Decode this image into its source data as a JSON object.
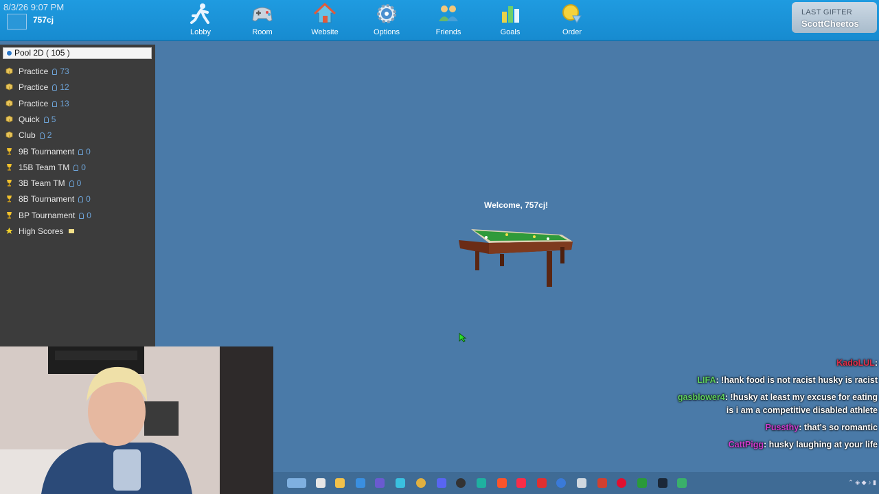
{
  "header": {
    "timestamp": "8/3/26 9:07 PM",
    "username": "757cj",
    "nav": [
      {
        "label": "Lobby",
        "icon": "runner-icon"
      },
      {
        "label": "Room",
        "icon": "gamepad-icon"
      },
      {
        "label": "Website",
        "icon": "house-icon"
      },
      {
        "label": "Options",
        "icon": "gear-icon"
      },
      {
        "label": "Friends",
        "icon": "people-icon"
      },
      {
        "label": "Goals",
        "icon": "bar-chart-icon"
      },
      {
        "label": "Order",
        "icon": "coin-icon"
      }
    ],
    "gifter_label": "LAST GIFTER",
    "gifter_name": "ScottCheetos"
  },
  "sidebar": {
    "title": "Pool 2D ( 105 )",
    "items": [
      {
        "label": "Practice",
        "count": "73",
        "icon": "box-icon"
      },
      {
        "label": "Practice",
        "count": "12",
        "icon": "box-icon"
      },
      {
        "label": "Practice",
        "count": "13",
        "icon": "box-icon"
      },
      {
        "label": "Quick",
        "count": "5",
        "icon": "box-icon"
      },
      {
        "label": "Club",
        "count": "2",
        "icon": "box-icon"
      },
      {
        "label": "9B Tournament",
        "count": "0",
        "icon": "trophy-icon"
      },
      {
        "label": "15B Team TM",
        "count": "0",
        "icon": "trophy-icon"
      },
      {
        "label": "3B Team TM",
        "count": "0",
        "icon": "trophy-icon"
      },
      {
        "label": "8B Tournament",
        "count": "0",
        "icon": "trophy-icon"
      },
      {
        "label": "BP Tournament",
        "count": "0",
        "icon": "trophy-icon"
      },
      {
        "label": "High Scores",
        "count": "",
        "icon": "star-icon"
      }
    ]
  },
  "main": {
    "welcome": "Welcome, 757cj!"
  },
  "chat": [
    {
      "user": "KadoLUL",
      "text": "",
      "color": "#e0304a"
    },
    {
      "user": "LIFA",
      "text": "!hank food is not racist husky is racist",
      "color": "#5fd05f"
    },
    {
      "user": "gasblower4",
      "text": "!husky at least my excuse for eating is i am a competitive disabled athlete",
      "color": "#5fd05f"
    },
    {
      "user": "Pussthy",
      "text": "that's so romantic",
      "color": "#d03cd0"
    },
    {
      "user": "CattPigg",
      "text": "husky laughing at your life",
      "color": "#d03cd0"
    }
  ],
  "colors": {
    "topbar": "#1f9be0",
    "background": "#4a7aa8",
    "sidebar": "#3c3c3c",
    "count_text": "#6ea4d8"
  }
}
